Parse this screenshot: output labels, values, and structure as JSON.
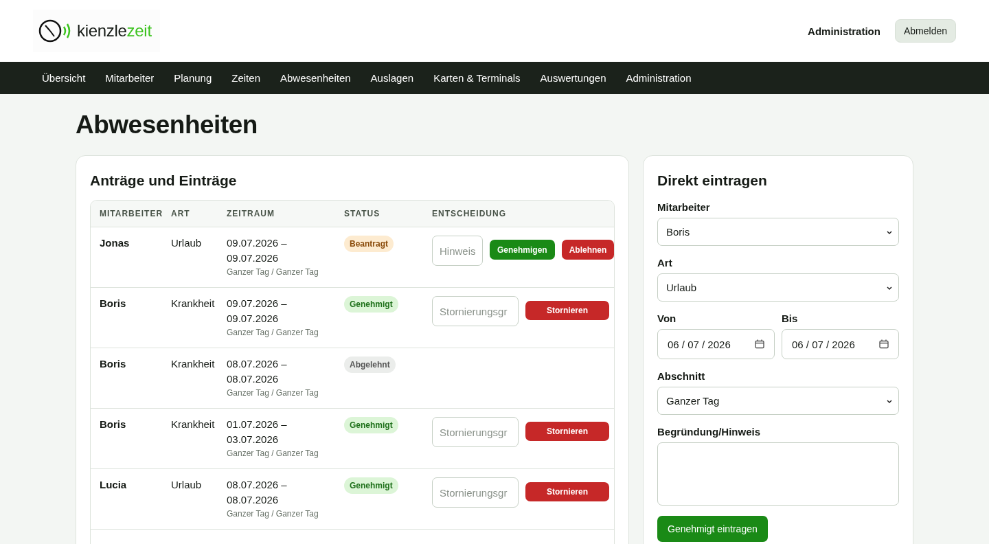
{
  "header": {
    "logo": {
      "text_dark": "kienzle",
      "text_accent": "zeit"
    },
    "admin_link": "Administration",
    "logout_button": "Abmelden"
  },
  "nav": [
    "Übersicht",
    "Mitarbeiter",
    "Planung",
    "Zeiten",
    "Abwesenheiten",
    "Auslagen",
    "Karten & Terminals",
    "Auswertungen",
    "Administration"
  ],
  "page_title": "Abwesenheiten",
  "requests": {
    "title": "Anträge und Einträge",
    "columns": [
      "MITARBEITER",
      "ART",
      "ZEITRAUM",
      "STATUS",
      "ENTSCHEIDUNG"
    ],
    "rows": [
      {
        "employee": "Jonas",
        "type": "Urlaub",
        "from": "09.07.2026 –",
        "to": "09.07.2026",
        "section": "Ganzer Tag / Ganzer Tag",
        "status": {
          "label": "Beantragt",
          "kind": "pending"
        },
        "decision": {
          "kind": "approve",
          "placeholder": "Hinweis",
          "buttons": [
            "Genehmigen",
            "Ablehnen"
          ]
        }
      },
      {
        "employee": "Boris",
        "type": "Krankheit",
        "from": "09.07.2026 –",
        "to": "09.07.2026",
        "section": "Ganzer Tag / Ganzer Tag",
        "status": {
          "label": "Genehmigt",
          "kind": "approved"
        },
        "decision": {
          "kind": "cancel",
          "placeholder": "Stornierungsgr",
          "buttons": [
            "Stornieren"
          ]
        }
      },
      {
        "employee": "Boris",
        "type": "Krankheit",
        "from": "08.07.2026 –",
        "to": "08.07.2026",
        "section": "Ganzer Tag / Ganzer Tag",
        "status": {
          "label": "Abgelehnt",
          "kind": "rejected"
        },
        "decision": {
          "kind": "none"
        }
      },
      {
        "employee": "Boris",
        "type": "Krankheit",
        "from": "01.07.2026 –",
        "to": "03.07.2026",
        "section": "Ganzer Tag / Ganzer Tag",
        "status": {
          "label": "Genehmigt",
          "kind": "approved"
        },
        "decision": {
          "kind": "cancel",
          "placeholder": "Stornierungsgr",
          "buttons": [
            "Stornieren"
          ]
        }
      },
      {
        "employee": "Lucia",
        "type": "Urlaub",
        "from": "08.07.2026 –",
        "to": "08.07.2026",
        "section": "Ganzer Tag / Ganzer Tag",
        "status": {
          "label": "Genehmigt",
          "kind": "approved"
        },
        "decision": {
          "kind": "cancel",
          "placeholder": "Stornierungsgr",
          "buttons": [
            "Stornieren"
          ]
        }
      }
    ]
  },
  "direct_entry": {
    "title": "Direkt eintragen",
    "fields": [
      {
        "kind": "select",
        "label": "Mitarbeiter",
        "value": "Boris"
      },
      {
        "kind": "select",
        "label": "Art",
        "value": "Urlaub"
      },
      {
        "kind": "dates",
        "items": [
          {
            "label": "Von",
            "value": "06 / 07 / 2026"
          },
          {
            "label": "Bis",
            "value": "06 / 07 / 2026"
          }
        ]
      },
      {
        "kind": "select",
        "label": "Abschnitt",
        "value": "Ganzer Tag"
      },
      {
        "kind": "textarea",
        "label": "Begründung/Hinweis"
      }
    ],
    "submit_button": "Genehmigt eintragen"
  }
}
